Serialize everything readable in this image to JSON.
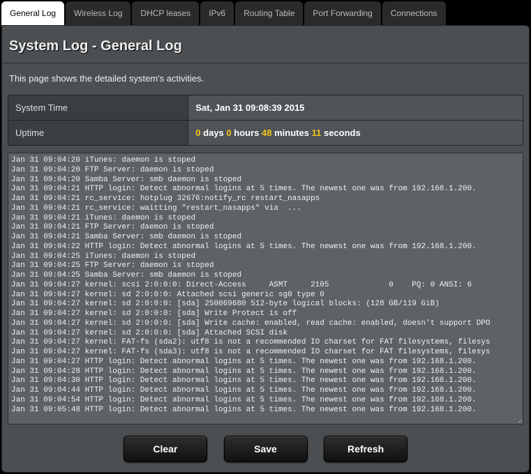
{
  "tabs": [
    {
      "label": "General Log",
      "active": true
    },
    {
      "label": "Wireless Log",
      "active": false
    },
    {
      "label": "DHCP leases",
      "active": false
    },
    {
      "label": "IPv6",
      "active": false
    },
    {
      "label": "Routing Table",
      "active": false
    },
    {
      "label": "Port Forwarding",
      "active": false
    },
    {
      "label": "Connections",
      "active": false
    }
  ],
  "page": {
    "title": "System Log - General Log",
    "description": "This page shows the detailed system's activities."
  },
  "info": {
    "system_time_label": "System Time",
    "system_time_value": "Sat, Jan 31 09:08:39 2015",
    "uptime_label": "Uptime",
    "uptime": {
      "days": "0",
      "days_word": "days",
      "hours": "0",
      "hours_word": "hours",
      "minutes": "48",
      "minutes_word": "minutes",
      "seconds": "11",
      "seconds_word": "seconds"
    }
  },
  "log_lines": [
    "Jan 31 09:04:20 iTunes: daemon is stoped",
    "Jan 31 09:04:20 FTP Server: daemon is stoped",
    "Jan 31 09:04:20 Samba Server: smb daemon is stoped",
    "Jan 31 09:04:21 HTTP login: Detect abnormal logins at 5 times. The newest one was from 192.168.1.200.",
    "Jan 31 09:04:21 rc_service: hotplug 32676:notify_rc restart_nasapps",
    "Jan 31 09:04:21 rc_service: waitting \"restart_nasapps\" via  ...",
    "Jan 31 09:04:21 iTunes: daemon is stoped",
    "Jan 31 09:04:21 FTP Server: daemon is stoped",
    "Jan 31 09:04:21 Samba Server: smb daemon is stoped",
    "Jan 31 09:04:22 HTTP login: Detect abnormal logins at 5 times. The newest one was from 192.168.1.200.",
    "Jan 31 09:04:25 iTunes: daemon is stoped",
    "Jan 31 09:04:25 FTP Server: daemon is stoped",
    "Jan 31 09:04:25 Samba Server: smb daemon is stoped",
    "Jan 31 09:04:27 kernel: scsi 2:0:0:0: Direct-Access     ASMT     2105             0    PQ: 0 ANSI: 6",
    "Jan 31 09:04:27 kernel: sd 2:0:0:0: Attached scsi generic sg0 type 0",
    "Jan 31 09:04:27 kernel: sd 2:0:0:0: [sda] 250069680 512-byte logical blocks: (128 GB/119 GiB)",
    "Jan 31 09:04:27 kernel: sd 2:0:0:0: [sda] Write Protect is off",
    "Jan 31 09:04:27 kernel: sd 2:0:0:0: [sda] Write cache: enabled, read cache: enabled, doesn't support DPO",
    "Jan 31 09:04:27 kernel: sd 2:0:0:0: [sda] Attached SCSI disk",
    "Jan 31 09:04:27 kernel: FAT-fs (sda2): utf8 is not a recommended IO charset for FAT filesystems, filesys",
    "Jan 31 09:04:27 kernel: FAT-fs (sda3): utf8 is not a recommended IO charset for FAT filesystems, filesys",
    "Jan 31 09:04:27 HTTP login: Detect abnormal logins at 5 times. The newest one was from 192.168.1.200.",
    "Jan 31 09:04:28 HTTP login: Detect abnormal logins at 5 times. The newest one was from 192.168.1.200.",
    "Jan 31 09:04:30 HTTP login: Detect abnormal logins at 5 times. The newest one was from 192.168.1.200.",
    "Jan 31 09:04:44 HTTP login: Detect abnormal logins at 5 times. The newest one was from 192.168.1.200.",
    "Jan 31 09:04:54 HTTP login: Detect abnormal logins at 5 times. The newest one was from 192.168.1.200.",
    "Jan 31 09:05:48 HTTP login: Detect abnormal logins at 5 times. The newest one was from 192.168.1.200."
  ],
  "buttons": {
    "clear": "Clear",
    "save": "Save",
    "refresh": "Refresh"
  }
}
